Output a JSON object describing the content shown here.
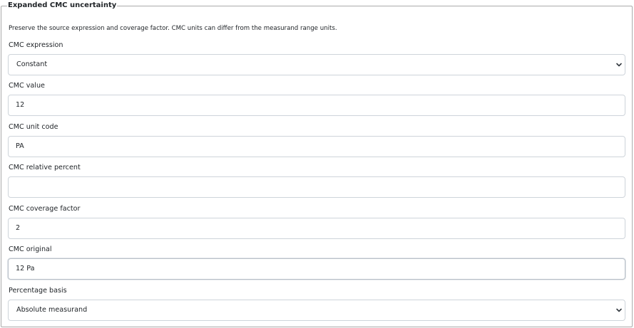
{
  "section": {
    "legend": "Expanded CMC uncertainty",
    "help_text": "Preserve the source expression and coverage factor. CMC units can differ from the measurand range units."
  },
  "fields": {
    "cmc_expression": {
      "label": "CMC expression",
      "value": "Constant"
    },
    "cmc_value": {
      "label": "CMC value",
      "value": "12"
    },
    "cmc_unit_code": {
      "label": "CMC unit code",
      "value": "PA"
    },
    "cmc_relative_percent": {
      "label": "CMC relative percent",
      "value": ""
    },
    "cmc_coverage_factor": {
      "label": "CMC coverage factor",
      "value": "2"
    },
    "cmc_original": {
      "label": "CMC original",
      "value": "12 Pa"
    },
    "percentage_basis": {
      "label": "Percentage basis",
      "value": "Absolute measurand"
    }
  },
  "icons": {
    "select_chevron": "chevron-down-icon"
  }
}
